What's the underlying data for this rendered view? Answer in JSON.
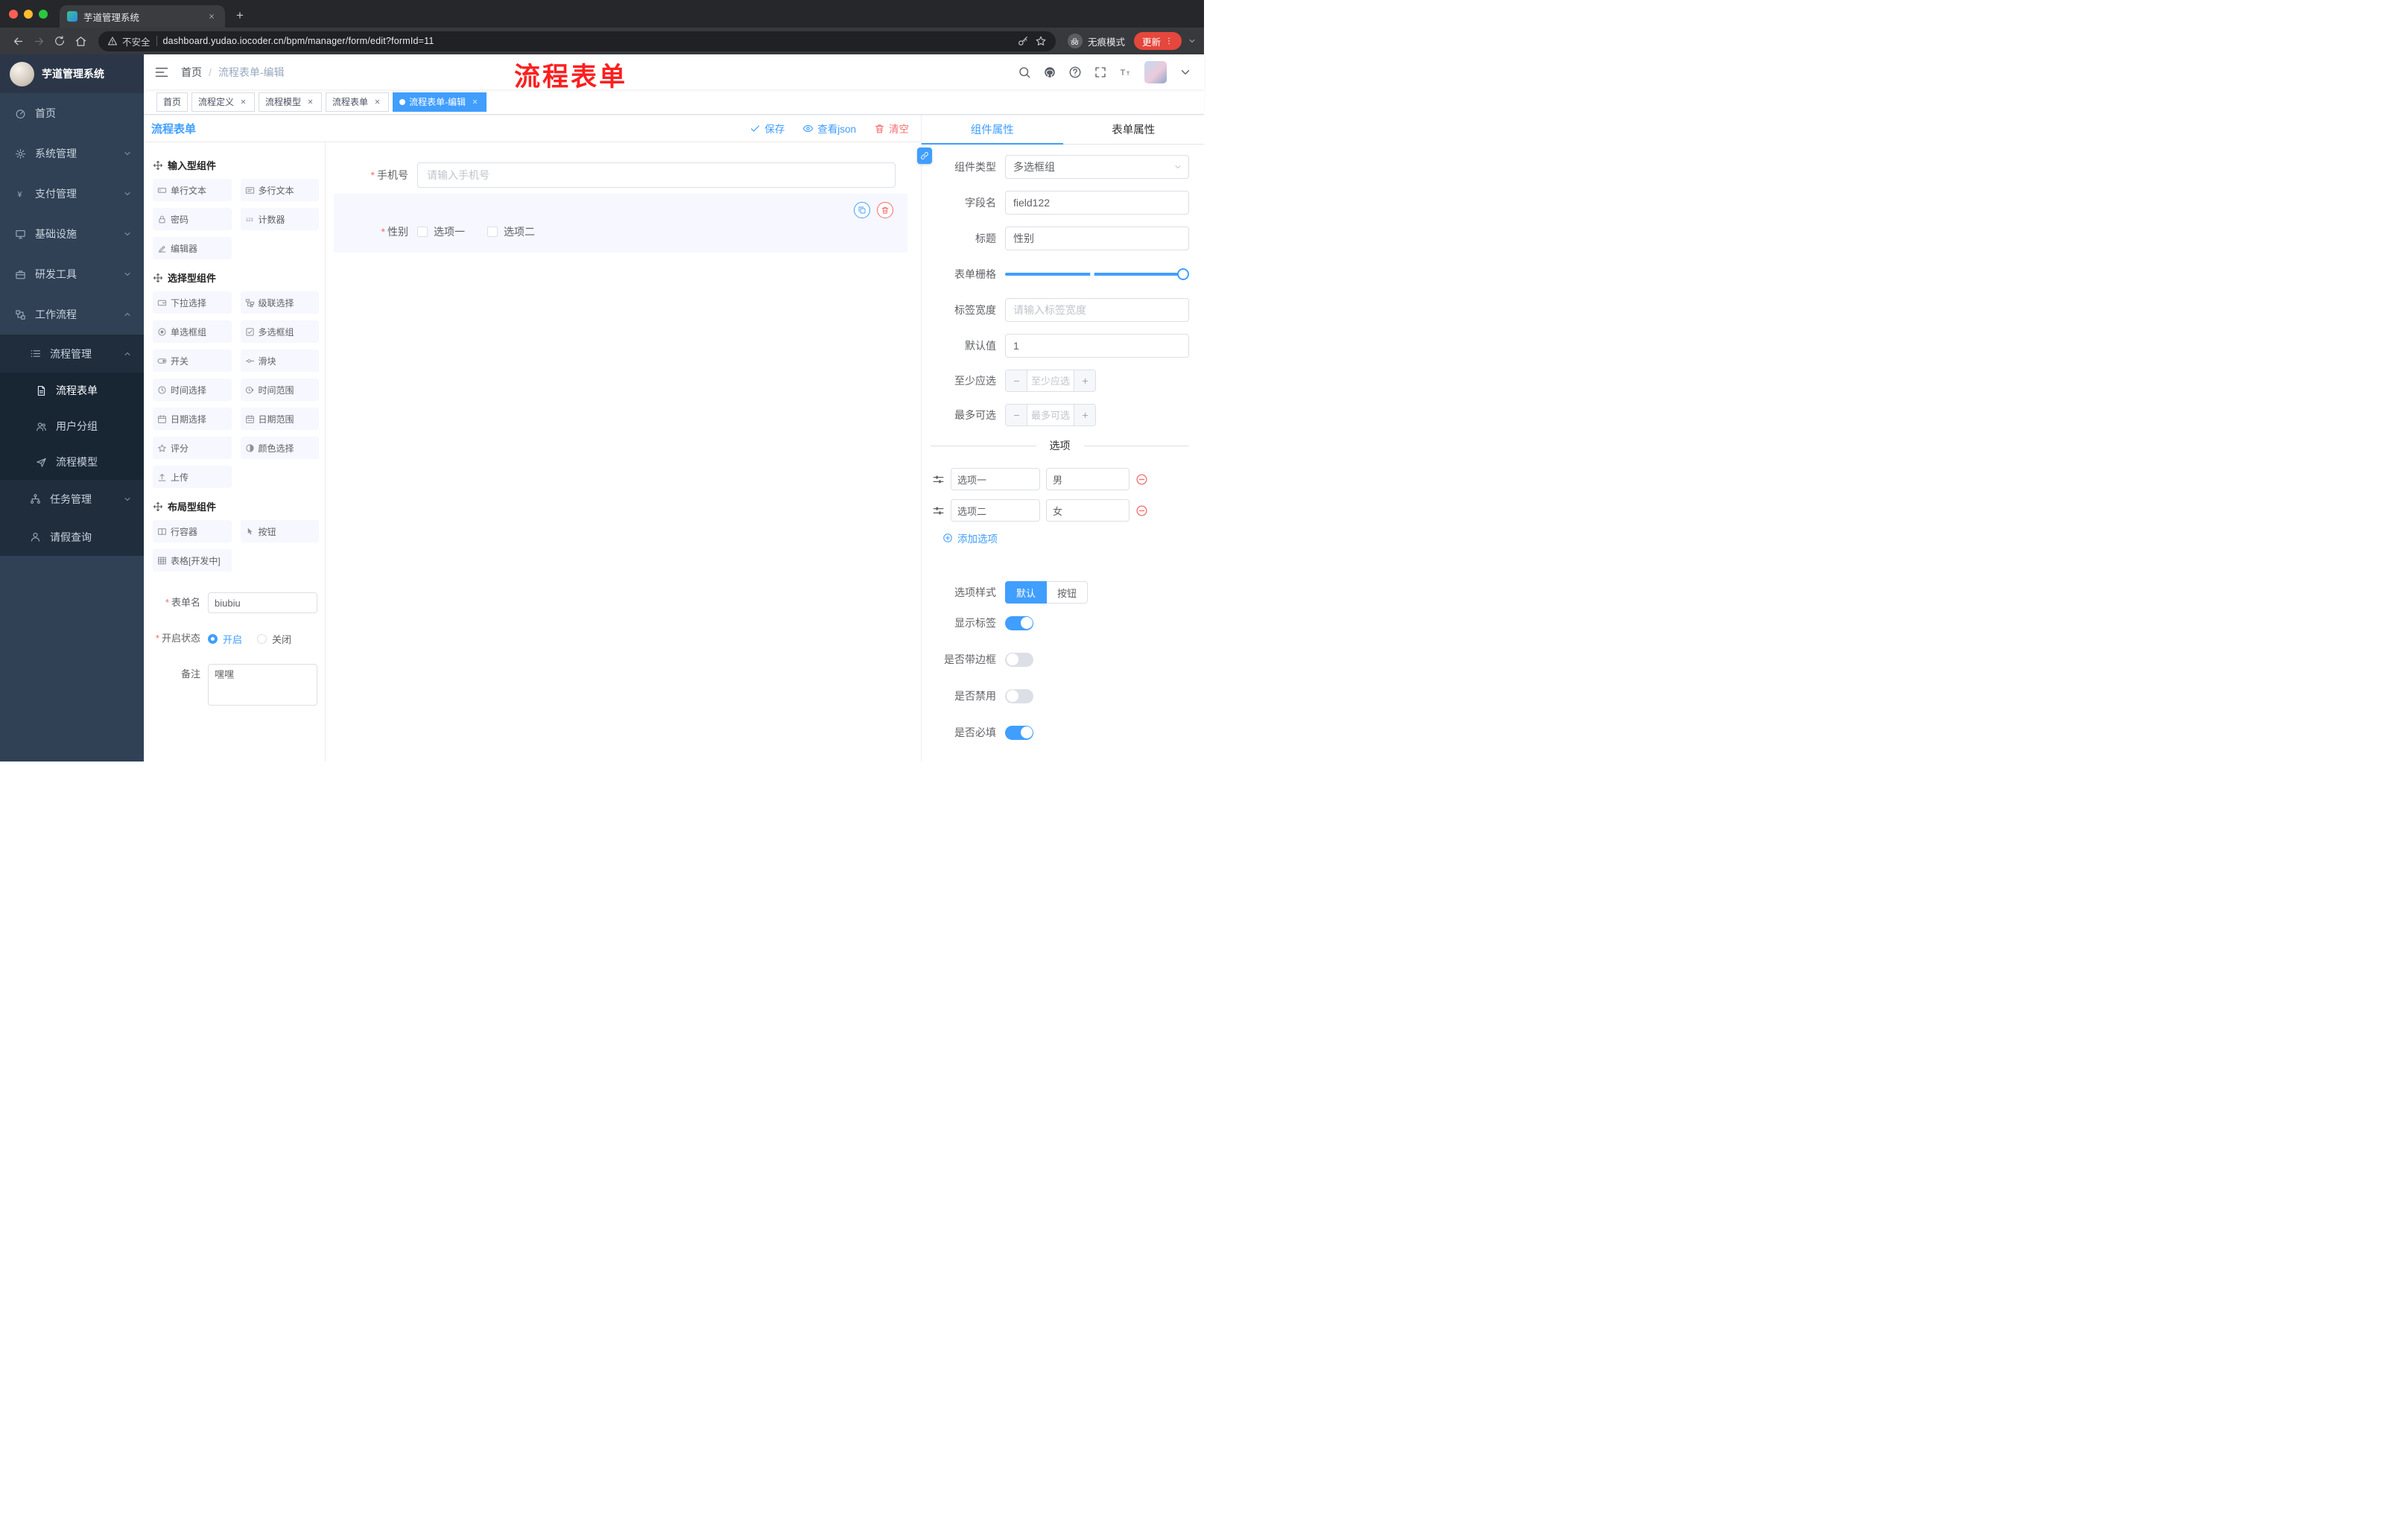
{
  "theme": {
    "accent": "#409EFF",
    "danger": "#F56C6C",
    "annotation_red": "#FC1F1F",
    "sidebar_bg": "#304156",
    "active_tag_bg": "#409EFF",
    "update_button_bg": "#E5473C"
  },
  "browser": {
    "tab_title": "芋道管理系统",
    "security_label": "不安全",
    "url": "dashboard.yudao.iocoder.cn/bpm/manager/form/edit?formId=11",
    "incognito_label": "无痕模式",
    "update_label": "更新"
  },
  "sidebar": {
    "logo_title": "芋道管理系统",
    "menu": {
      "home": "首页",
      "system": "系统管理",
      "payment": "支付管理",
      "infra": "基础设施",
      "devtools": "研发工具",
      "workflow": "工作流程",
      "process_mgmt": "流程管理",
      "process_form": "流程表单",
      "user_group": "用户分组",
      "process_model": "流程模型",
      "task_mgmt": "任务管理",
      "leave_query": "请假查询"
    }
  },
  "header": {
    "breadcrumb_home": "首页",
    "breadcrumb_current": "流程表单-编辑",
    "annotation": "流程表单"
  },
  "tags": {
    "t0": "首页",
    "t1": "流程定义",
    "t2": "流程模型",
    "t3": "流程表单",
    "t4": "流程表单-编辑"
  },
  "designer": {
    "panel_title": "流程表单",
    "save": "保存",
    "view_json": "查看json",
    "clear": "清空",
    "palette": {
      "section_input": "输入型组件",
      "items_input": {
        "single": "单行文本",
        "multi": "多行文本",
        "password": "密码",
        "counter": "计数器",
        "editor": "编辑器"
      },
      "section_select": "选择型组件",
      "items_select": {
        "select": "下拉选择",
        "cascader": "级联选择",
        "radio": "单选框组",
        "checkbox": "多选框组",
        "switch": "开关",
        "slider": "滑块",
        "time": "时间选择",
        "time_range": "时间范围",
        "date": "日期选择",
        "date_range": "日期范围",
        "rate": "评分",
        "color": "颜色选择",
        "upload": "上传"
      },
      "section_layout": "布局型组件",
      "items_layout": {
        "row": "行容器",
        "button": "按钮",
        "table": "表格[开发中]"
      }
    },
    "meta": {
      "name_label": "表单名",
      "name_value": "biubiu",
      "status_label": "开启状态",
      "status_on": "开启",
      "status_off": "关闭",
      "remark_label": "备注",
      "remark_value": "嘿嘿"
    },
    "canvas": {
      "phone_label": "手机号",
      "phone_placeholder": "请输入手机号",
      "gender_label": "性别",
      "gender_opt1": "选项一",
      "gender_opt2": "选项二"
    }
  },
  "inspector": {
    "tab_component": "组件属性",
    "tab_form": "表单属性",
    "component_type_label": "组件类型",
    "component_type_value": "多选框组",
    "field_name_label": "字段名",
    "field_name_value": "field122",
    "title_label": "标题",
    "title_value": "性别",
    "grid_label": "表单栅格",
    "label_width_label": "标签宽度",
    "label_width_placeholder": "请输入标签宽度",
    "default_label": "默认值",
    "default_value": "1",
    "min_label": "至少应选",
    "min_placeholder": "至少应选",
    "max_label": "最多可选",
    "max_placeholder": "最多可选",
    "options_divider": "选项",
    "opt1_label": "选项一",
    "opt1_value": "男",
    "opt2_label": "选项二",
    "opt2_value": "女",
    "add_option": "添加选项",
    "style_label": "选项样式",
    "style_default": "默认",
    "style_button": "按钮",
    "show_label": "显示标签",
    "border_label": "是否带边框",
    "disabled_label": "是否禁用",
    "required_label": "是否必填"
  }
}
